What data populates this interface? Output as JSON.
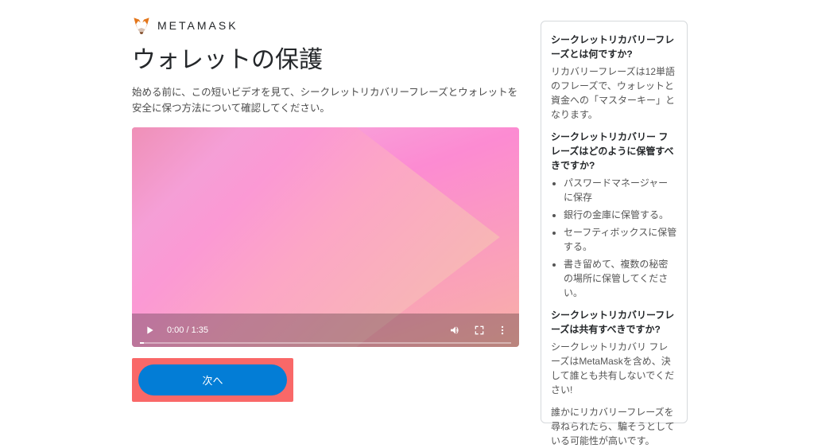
{
  "brand": {
    "name": "METAMASK"
  },
  "title": "ウォレットの保護",
  "description": "始める前に、この短いビデオを見て、シークレットリカバリーフレーズとウォレットを安全に保つ方法について確認してください。",
  "video": {
    "timecode": "0:00 / 1:35"
  },
  "buttons": {
    "next": "次へ"
  },
  "sidebar": {
    "q1": "シークレットリカバリーフレーズとは何ですか?",
    "a1": "リカバリーフレーズは12単語のフレーズで、ウォレットと資金への「マスターキー」となります。",
    "q2": "シークレットリカバリー フレーズはどのように保管すべきですか?",
    "list": [
      "パスワードマネージャーに保存",
      "銀行の金庫に保管する。",
      "セーフティボックスに保管する。",
      "書き留めて、複数の秘密の場所に保管してください。"
    ],
    "q3": "シークレットリカバリーフレーズは共有すべきですか?",
    "a3": "シークレットリカバリ フレーズはMetaMaskを含め、決して誰とも共有しないでください!",
    "a3b": "誰かにリカバリーフレーズを尋ねられたら、騙そうとしている可能性が高いです。"
  }
}
